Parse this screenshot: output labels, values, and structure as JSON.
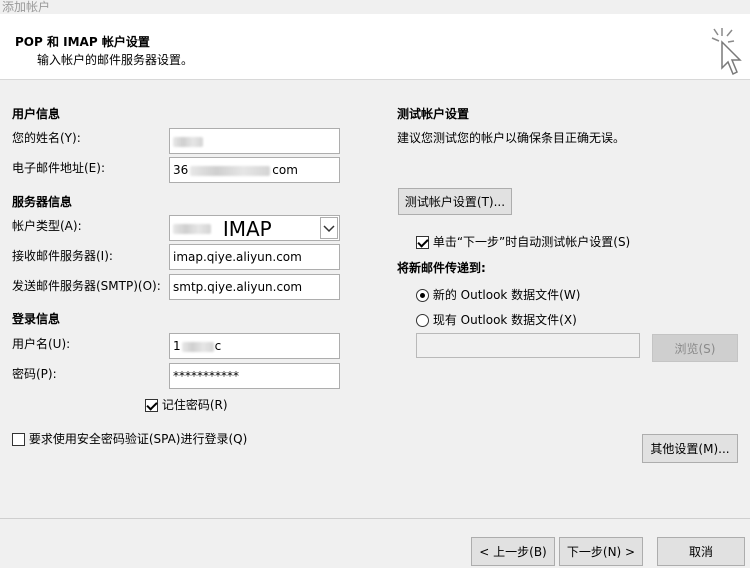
{
  "window": {
    "title": "添加帐户"
  },
  "header": {
    "title": "POP 和 IMAP 帐户设置",
    "subtitle": "输入帐户的邮件服务器设置。"
  },
  "user_info": {
    "section": "用户信息",
    "name_label": "您的姓名(Y):",
    "email_label": "电子邮件地址(E):",
    "email_prefix": "36",
    "email_suffix": "com"
  },
  "server_info": {
    "section": "服务器信息",
    "account_type_label": "帐户类型(A):",
    "account_type_value": "IMAP",
    "incoming_label": "接收邮件服务器(I):",
    "incoming_value": "imap.qiye.aliyun.com",
    "outgoing_label": "发送邮件服务器(SMTP)(O):",
    "outgoing_value": "smtp.qiye.aliyun.com"
  },
  "login_info": {
    "section": "登录信息",
    "username_label": "用户名(U):",
    "username_prefix": "1",
    "username_suffix": "c",
    "password_label": "密码(P):",
    "password_value": "***********",
    "remember_label": "记住密码(R)",
    "spa_label": "要求使用安全密码验证(SPA)进行登录(Q)"
  },
  "test_settings": {
    "section": "测试帐户设置",
    "description": "建议您测试您的帐户以确保条目正确无误。",
    "test_button": "测试帐户设置(T)...",
    "auto_test_label": "单击“下一步”时自动测试帐户设置(S)",
    "deliver_title": "将新邮件传递到:",
    "new_datafile_label": "新的 Outlook 数据文件(W)",
    "existing_datafile_label": "现有 Outlook 数据文件(X)",
    "browse_button": "浏览(S)",
    "more_settings_button": "其他设置(M)..."
  },
  "footer": {
    "back_button": "< 上一步(B)",
    "next_button": "下一步(N) >",
    "cancel_button": "取消"
  }
}
